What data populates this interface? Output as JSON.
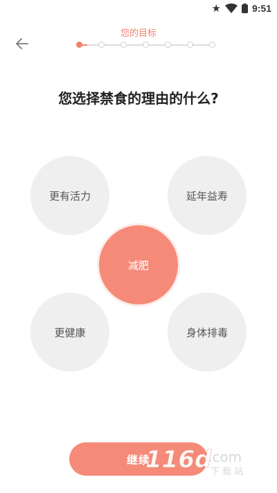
{
  "status_bar": {
    "time": "9:51",
    "icons": [
      "star-icon",
      "wifi-icon",
      "battery-icon"
    ]
  },
  "header": {
    "back_icon": "arrow-left-icon",
    "step_title": "您的目标",
    "progress": {
      "total_steps": 7,
      "current_step": 1
    }
  },
  "question": "您选择禁食的理由的什么?",
  "options": [
    {
      "label": "更有活力",
      "selected": false
    },
    {
      "label": "延年益寿",
      "selected": false
    },
    {
      "label": "减肥",
      "selected": true
    },
    {
      "label": "更健康",
      "selected": false
    },
    {
      "label": "身体排毒",
      "selected": false
    }
  ],
  "continue_label": "继续",
  "watermark": "116d.com 下载站",
  "colors": {
    "accent": "#f58a79",
    "option_bg": "#efefef",
    "title_accent": "#f3806f"
  }
}
